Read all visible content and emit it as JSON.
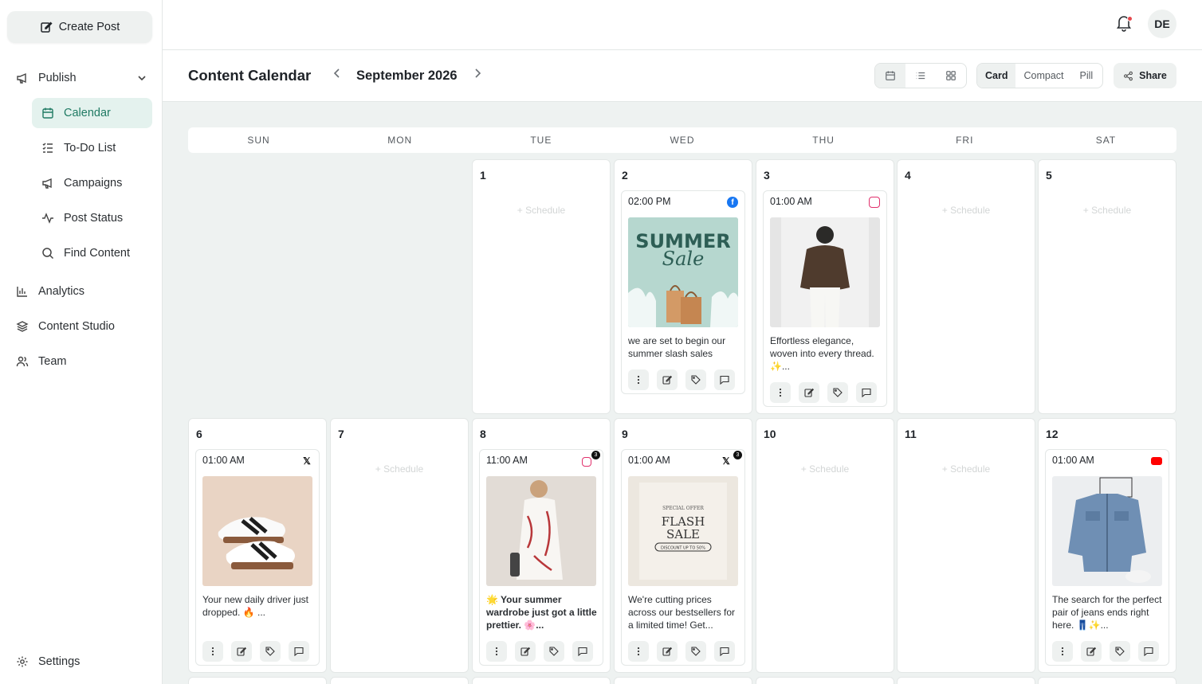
{
  "sidebar": {
    "create_label": "Create Post",
    "publish_label": "Publish",
    "sub_items": [
      "Calendar",
      "To-Do List",
      "Campaigns",
      "Post Status",
      "Find Content"
    ],
    "items": [
      "Analytics",
      "Content Studio",
      "Team"
    ],
    "settings_label": "Settings"
  },
  "topbar": {
    "avatar_initials": "DE"
  },
  "header": {
    "title": "Content Calendar",
    "month": "September 2026",
    "styles": [
      "Card",
      "Compact",
      "Pill"
    ],
    "share_label": "Share"
  },
  "calendar": {
    "days_of_week": [
      "SUN",
      "MON",
      "TUE",
      "WED",
      "THU",
      "FRI",
      "SAT"
    ],
    "schedule_label": "+ Schedule",
    "days": [
      "1",
      "2",
      "3",
      "4",
      "5",
      "6",
      "7",
      "8",
      "9",
      "10",
      "11",
      "12"
    ],
    "posts": [
      {
        "day": "2",
        "time": "02:00 PM",
        "platform": "facebook",
        "caption": "we are set to begin our summer slash sales",
        "thumb_text_1": "SUMMER",
        "thumb_text_2": "Sale"
      },
      {
        "day": "3",
        "time": "01:00 AM",
        "platform": "instagram",
        "caption": "Effortless elegance, woven into every thread. ✨..."
      },
      {
        "day": "6",
        "time": "01:00 AM",
        "platform": "x",
        "caption": "Your new daily driver just dropped. 🔥 ..."
      },
      {
        "day": "8",
        "time": "11:00 AM",
        "platform": "instagram",
        "badge": "3",
        "caption": "🌟 Your summer wardrobe just got a little prettier. 🌸..."
      },
      {
        "day": "9",
        "time": "01:00 AM",
        "platform": "x",
        "badge": "3",
        "caption": "We're cutting prices across our bestsellers for a limited time! Get...",
        "thumb_text_1": "FLASH",
        "thumb_text_2": "SALE",
        "thumb_text_3": "DISCOUNT UP TO 50%",
        "thumb_text_4": "SPECIAL OFFER"
      },
      {
        "day": "12",
        "time": "01:00 AM",
        "platform": "youtube",
        "caption": "The search for the perfect pair of jeans ends right here. 👖✨..."
      }
    ]
  },
  "colors": {
    "accent": "#1f7a63",
    "active_bg": "#e4f2ee",
    "canvas": "#eef2f1"
  }
}
